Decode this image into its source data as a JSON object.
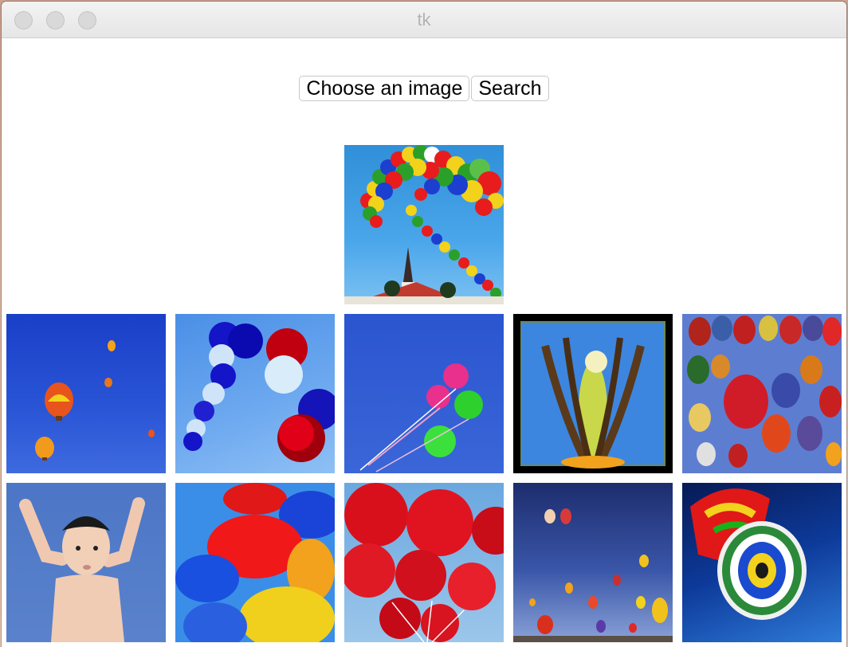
{
  "window": {
    "title": "tk"
  },
  "toolbar": {
    "choose_label": "Choose an image",
    "search_label": "Search"
  },
  "query_image": {
    "subject": "balloon-arch-over-church"
  },
  "results": [
    {
      "subject": "hot-air-balloons-blue-sky"
    },
    {
      "subject": "red-blue-balloons-arc"
    },
    {
      "subject": "bunch-of-balloons-with-strings"
    },
    {
      "subject": "flower-stamen-closeup"
    },
    {
      "subject": "hot-air-balloon-collection"
    },
    {
      "subject": "baby-arms-raised"
    },
    {
      "subject": "red-yellow-balloons"
    },
    {
      "subject": "red-balloons-cluster"
    },
    {
      "subject": "balloon-festival-crowd"
    },
    {
      "subject": "hot-air-balloon-from-below"
    }
  ],
  "colors": {
    "sky_blue": "#2a55d6",
    "balloon_red": "#e01818",
    "window_bg": "#ffffff"
  }
}
